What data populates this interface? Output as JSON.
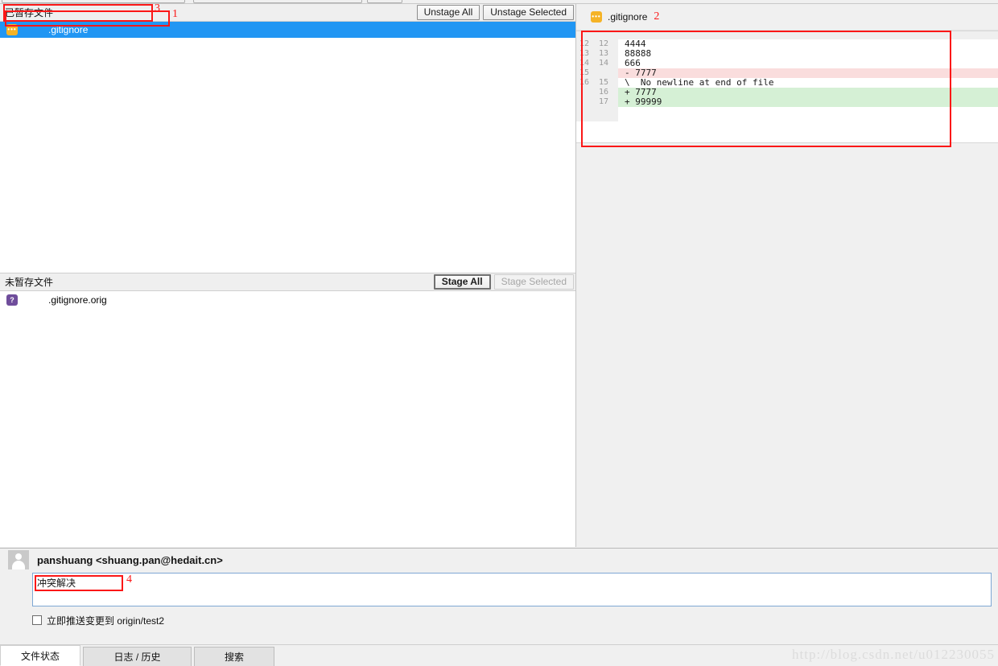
{
  "staged_panel": {
    "title": "已暂存文件",
    "buttons": [
      {
        "label": "Unstage All",
        "enabled": true
      },
      {
        "label": "Unstage Selected",
        "enabled": true
      }
    ],
    "files": [
      {
        "name": ".gitignore",
        "status_icon": "modified-file-icon",
        "selected": true
      }
    ]
  },
  "unstaged_panel": {
    "title": "未暂存文件",
    "buttons": [
      {
        "label": "Stage All",
        "enabled": true,
        "default": true
      },
      {
        "label": "Stage Selected",
        "enabled": false
      }
    ],
    "files": [
      {
        "name": ".gitignore.orig",
        "status_icon": "untracked-file-icon",
        "selected": false
      }
    ]
  },
  "diff_panel": {
    "file_name": ".gitignore",
    "file_icon": "modified-file-icon",
    "lines": [
      {
        "old": "12",
        "new": "12",
        "marker": " ",
        "text": "4444",
        "type": "ctx"
      },
      {
        "old": "13",
        "new": "13",
        "marker": " ",
        "text": "88888",
        "type": "ctx"
      },
      {
        "old": "14",
        "new": "14",
        "marker": " ",
        "text": "666",
        "type": "ctx"
      },
      {
        "old": "15",
        "new": "",
        "marker": "-",
        "text": "7777",
        "type": "del"
      },
      {
        "old": "16",
        "new": "15",
        "marker": "\\",
        "text": " No newline at end of file",
        "type": "meta"
      },
      {
        "old": "",
        "new": "16",
        "marker": "+",
        "text": "7777",
        "type": "add"
      },
      {
        "old": "",
        "new": "17",
        "marker": "+",
        "text": "99999",
        "type": "add"
      }
    ]
  },
  "commit": {
    "author": "panshuang <shuang.pan@hedait.cn>",
    "message": "冲突解决",
    "message_placeholder": "",
    "push_checkbox_label": "立即推送变更到 origin/test2",
    "push_checked": false
  },
  "tabs": [
    {
      "label": "文件状态",
      "active": true
    },
    {
      "label": "日志 / 历史",
      "active": false
    },
    {
      "label": "搜索",
      "active": false
    }
  ],
  "annotations": [
    {
      "number": "1"
    },
    {
      "number": "2"
    },
    {
      "number": "3"
    },
    {
      "number": "4"
    }
  ],
  "watermark": "http://blog.csdn.net/u012230055",
  "colors": {
    "selection": "#2196f3",
    "annotation": "#fb1717",
    "diff_add": "#d5f0d5",
    "diff_del": "#fadddd",
    "modified_icon": "#f5b326",
    "untracked_icon": "#6f4d9b"
  }
}
